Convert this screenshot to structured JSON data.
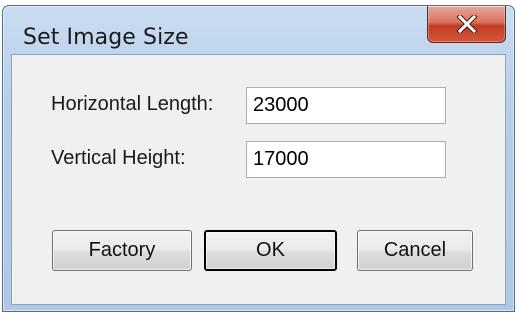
{
  "window": {
    "title": "Set Image Size"
  },
  "icons": {
    "close": "close-icon"
  },
  "form": {
    "horizontal_label": "Horizontal Length:",
    "horizontal_value": "23000",
    "vertical_label": "Vertical Height:",
    "vertical_value": "17000"
  },
  "buttons": {
    "factory": "Factory",
    "ok": "OK",
    "cancel": "Cancel"
  },
  "colors": {
    "close_button": "#c94a30",
    "frame": "#b8cfea",
    "client": "#f0f0f0"
  }
}
